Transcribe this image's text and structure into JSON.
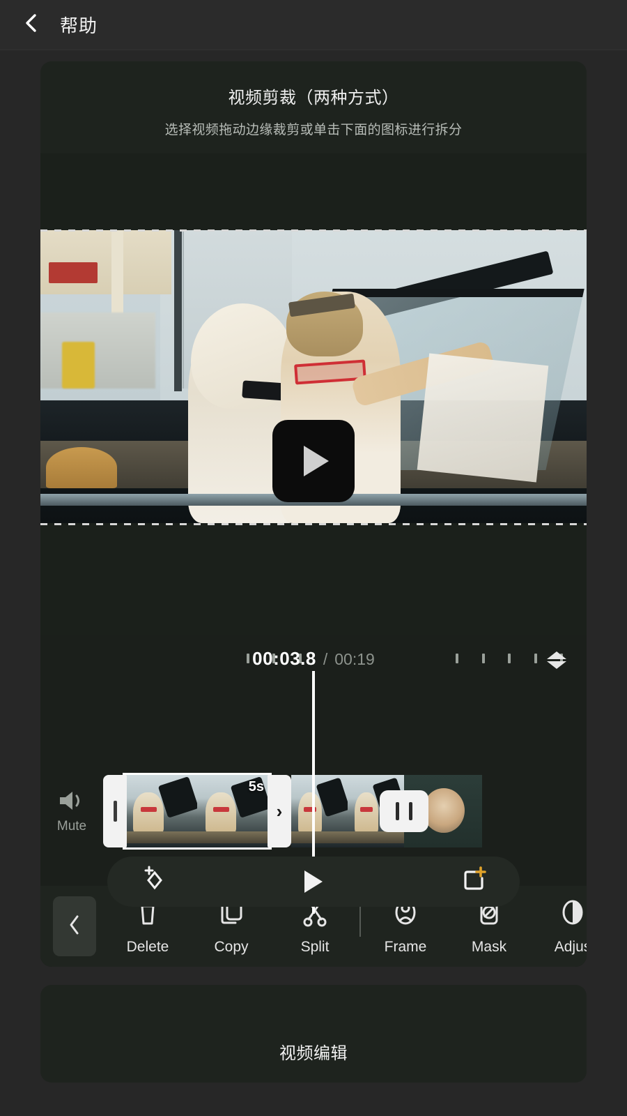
{
  "header": {
    "back_icon": "chevron-left-icon",
    "title": "帮助"
  },
  "help_card": {
    "title": "视频剪裁（两种方式）",
    "subtitle": "选择视频拖动边缘裁剪或单击下面的图标进行拆分"
  },
  "preview": {
    "play_icon": "play-triangle-icon"
  },
  "timeline": {
    "current_time": "00:03.8",
    "separator": "/",
    "total_time": "00:19",
    "expand_icon": "expand-collapse-icon",
    "mute_label": "Mute",
    "mute_icon": "speaker-icon",
    "clip_duration_badge": "5s",
    "trim_left_icon": "trim-handle-left-icon",
    "trim_right_icon": "chevron-right-icon",
    "transition_icon": "transition-pause-icon"
  },
  "action_bar": {
    "effects_icon": "sparkle-add-icon",
    "play_icon": "play-triangle-icon",
    "crop_icon": "crop-add-icon",
    "crop_accent_color": "#e0a22a"
  },
  "toolbar": {
    "collapse_icon": "chevron-left-icon",
    "items": [
      {
        "label": "Delete",
        "icon": "trash-icon"
      },
      {
        "label": "Copy",
        "icon": "copy-icon"
      },
      {
        "label": "Split",
        "icon": "scissors-icon"
      },
      {
        "label": "Frame",
        "icon": "person-frame-icon"
      },
      {
        "label": "Mask",
        "icon": "mask-icon"
      },
      {
        "label": "Adjus",
        "icon": "contrast-icon"
      }
    ]
  },
  "bottom_card": {
    "title": "视频编辑"
  },
  "colors": {
    "page_bg": "#272727",
    "card_bg": "#1e231e",
    "header_bg": "#2b2b2b",
    "accent": "#e0a22a",
    "text_primary": "#f0f0f0",
    "text_secondary": "#9aa09a"
  }
}
